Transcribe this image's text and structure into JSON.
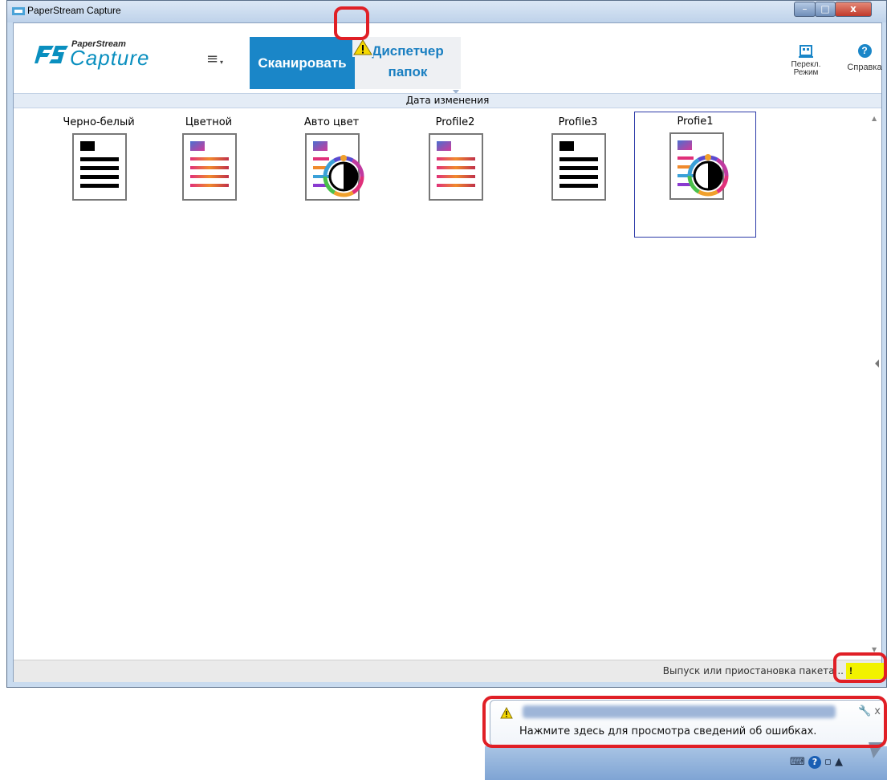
{
  "window": {
    "title": "PaperStream Capture"
  },
  "window_controls": {
    "minimize": "–",
    "maximize": "□",
    "close": "x"
  },
  "logo": {
    "small": "PaperStream",
    "big": "Capture"
  },
  "ribbon": {
    "menu_icon": "≡",
    "menu_arrow": "▾",
    "tab_scan": "Сканировать",
    "tab_folder_line1": "Диспетчер",
    "tab_folder_line2": "папок",
    "switch_line1": "Перекл.",
    "switch_line2": "Режим",
    "help_label": "Справка",
    "help_symbol": "?"
  },
  "sort_header": {
    "label": "Дата изменения"
  },
  "profiles": [
    {
      "name": "Черно-белый",
      "icon": "bw-document-icon"
    },
    {
      "name": "Цветной",
      "icon": "color-document-icon"
    },
    {
      "name": "Авто цвет",
      "icon": "auto-color-document-icon"
    },
    {
      "name": "Profile2",
      "icon": "color-document-icon"
    },
    {
      "name": "Profile3",
      "icon": "bw-document-icon"
    },
    {
      "name": "Profie1",
      "icon": "auto-color-document-icon",
      "selected": true
    }
  ],
  "statusbar": {
    "text": "Выпуск или приостановка пакета...",
    "warning_symbol": "!"
  },
  "balloon": {
    "message": "Нажмите здесь для просмотра сведений об ошибках.",
    "tools": "🔧 x"
  },
  "tray": {
    "help": "?"
  },
  "colors": {
    "scan_tab": "#1a86c8",
    "folder_tab_text": "#1a7fc1",
    "highlight": "#e01f26",
    "status_warning": "#f2f200"
  }
}
